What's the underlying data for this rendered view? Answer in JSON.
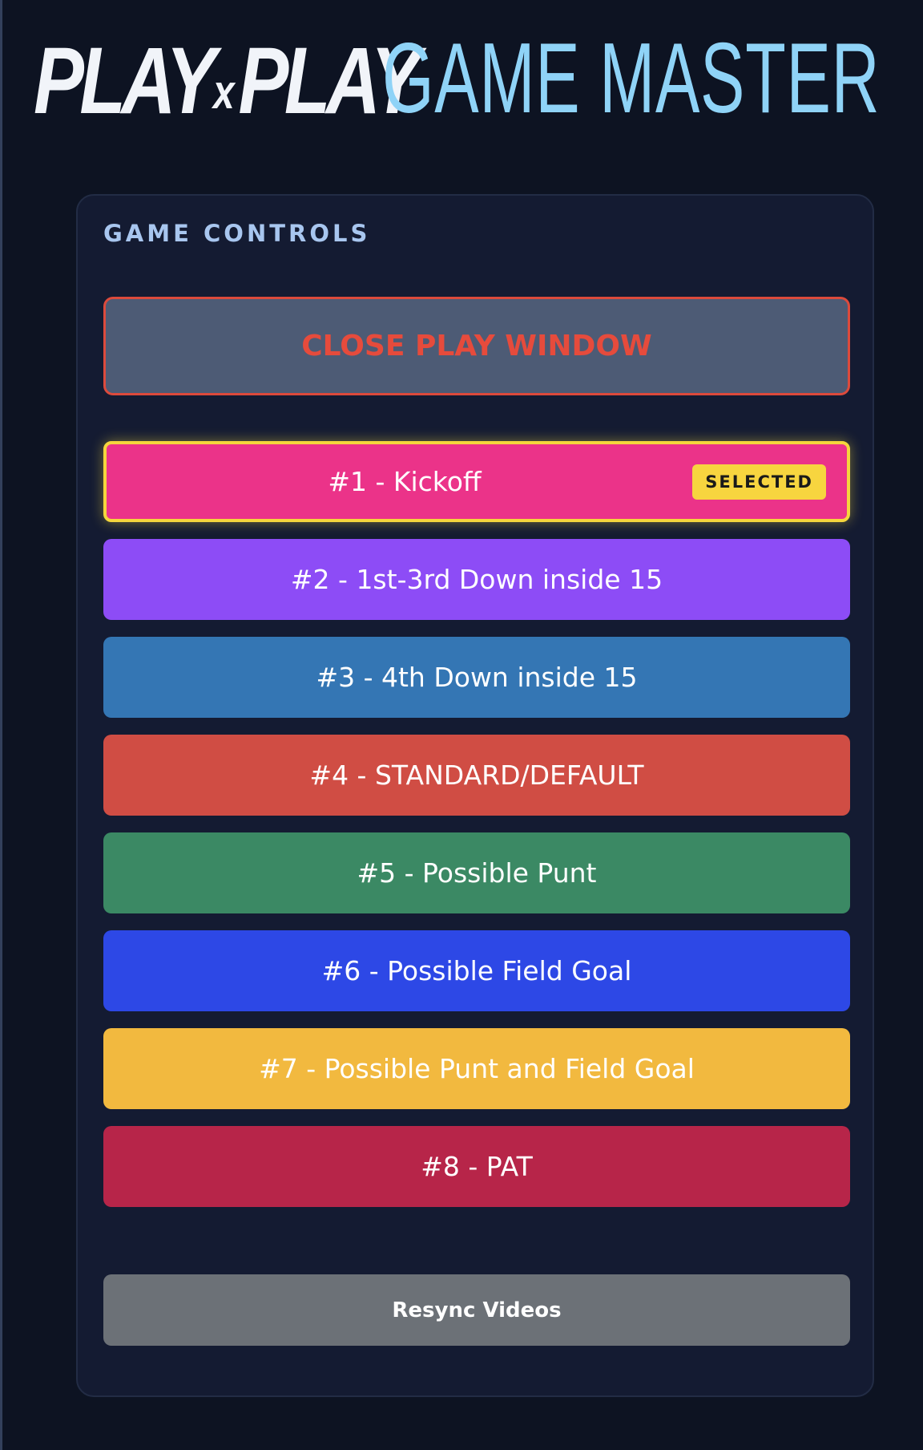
{
  "header": {
    "logo_part1": "PLAY",
    "logo_x": "x",
    "logo_part2": "PLAY",
    "title": "GAME MASTER"
  },
  "panel": {
    "title": "GAME CONTROLS",
    "close_button": "CLOSE PLAY WINDOW",
    "selected_badge": "SELECTED",
    "plays": [
      {
        "label": "#1 - Kickoff",
        "color": "#eb3389",
        "selected": true
      },
      {
        "label": "#2 - 1st-3rd Down inside 15",
        "color": "#8d4cf6",
        "selected": false
      },
      {
        "label": "#3 - 4th Down inside 15",
        "color": "#3476b4",
        "selected": false
      },
      {
        "label": "#4 - STANDARD/DEFAULT",
        "color": "#d04d44",
        "selected": false
      },
      {
        "label": "#5 - Possible Punt",
        "color": "#3b8964",
        "selected": false
      },
      {
        "label": "#6 - Possible Field Goal",
        "color": "#2d48e6",
        "selected": false
      },
      {
        "label": "#7 - Possible Punt and Field Goal",
        "color": "#f2b93f",
        "selected": false
      },
      {
        "label": "#8 - PAT",
        "color": "#b72549",
        "selected": false
      }
    ],
    "resync_button": "Resync Videos"
  }
}
